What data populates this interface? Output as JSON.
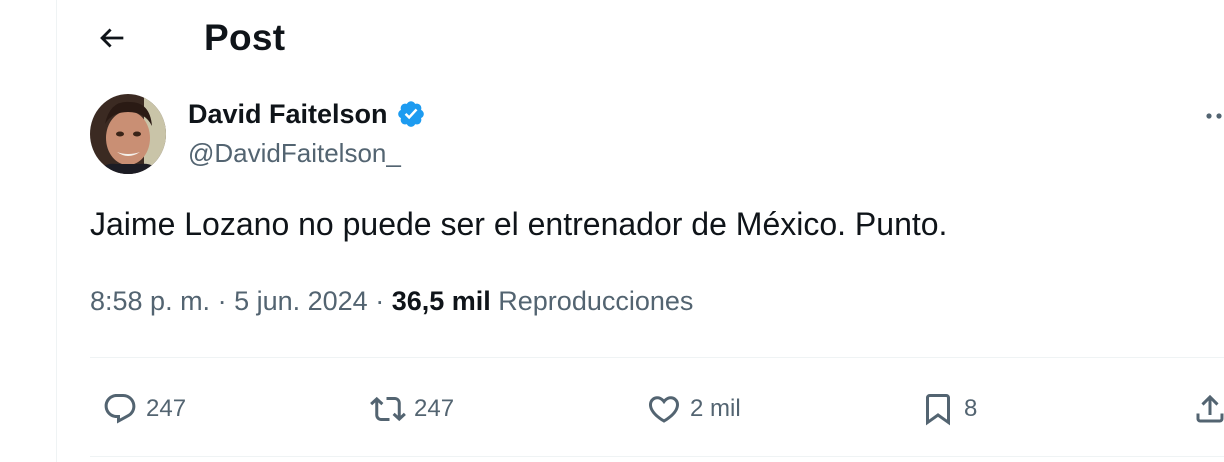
{
  "header": {
    "title": "Post"
  },
  "author": {
    "name": "David Faitelson",
    "handle": "@DavidFaitelson_"
  },
  "tweet": {
    "text": "Jaime Lozano no puede ser el entrenador de México. Punto."
  },
  "meta": {
    "time": "8:58 p. m.",
    "separator": " · ",
    "date": "5 jun. 2024",
    "views_count": "36,5 mil",
    "views_label": "Reproducciones"
  },
  "actions": {
    "replies": "247",
    "reposts": "247",
    "likes": "2 mil",
    "bookmarks": "8"
  },
  "colors": {
    "verified": "#1d9bf0",
    "text": "#0f1419",
    "secondary": "#536471",
    "divider": "#eff3f4"
  },
  "icons": [
    "back-arrow-icon",
    "verified-badge-icon",
    "more-icon",
    "reply-icon",
    "repost-icon",
    "like-icon",
    "bookmark-icon",
    "share-icon"
  ]
}
